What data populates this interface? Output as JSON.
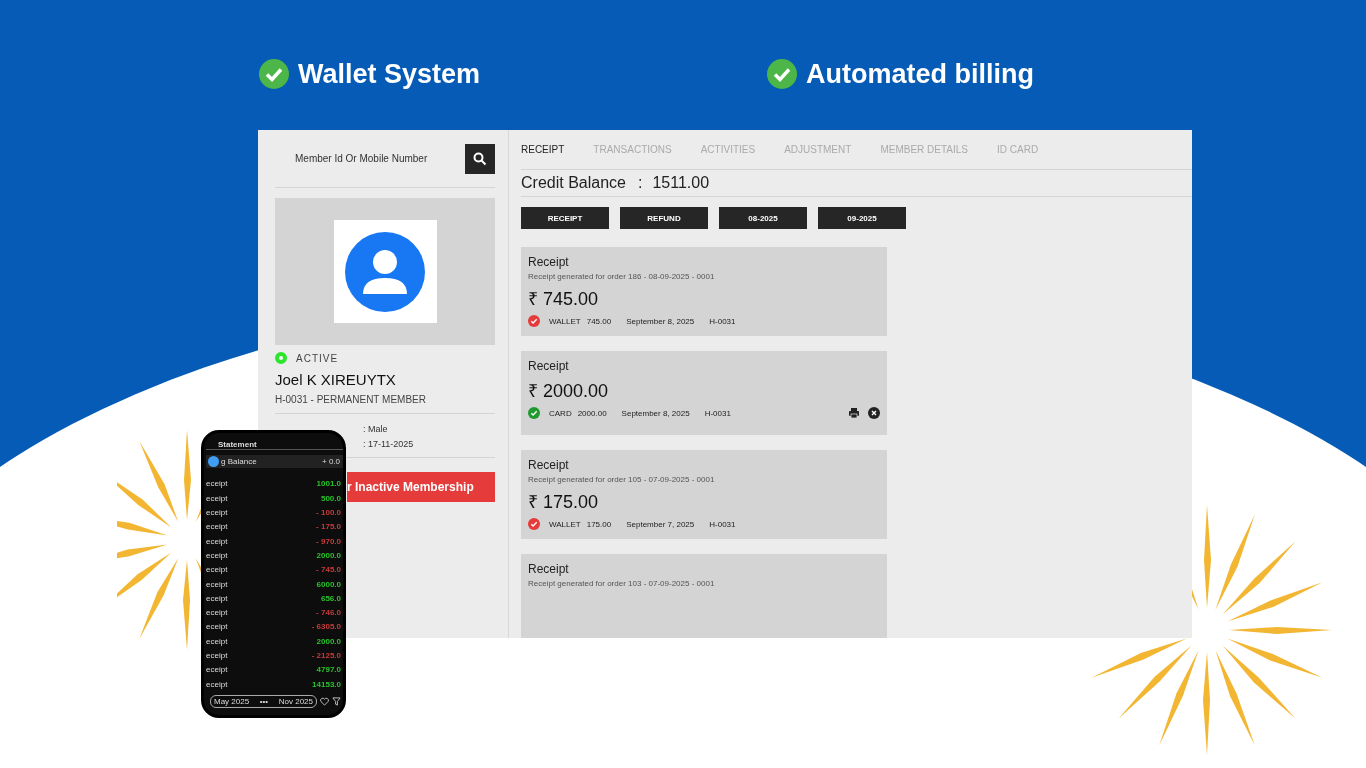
{
  "headlines": [
    {
      "label": "Wallet System"
    },
    {
      "label": "Automated billing"
    }
  ],
  "search": {
    "placeholder": "Member Id Or Mobile Number"
  },
  "member": {
    "status": "ACTIVE",
    "active": true,
    "name": "Joel K XIREUYTX",
    "id_line": "H-0031 - PERMANENT MEMBER",
    "details": [
      ": Male",
      ": 17-11-2025"
    ],
    "action": "r Inactive Membership"
  },
  "tabs": [
    {
      "label": "RECEIPT",
      "selected": true
    },
    {
      "label": "TRANSACTIONS",
      "selected": false
    },
    {
      "label": "ACTIVITIES",
      "selected": false
    },
    {
      "label": "ADJUSTMENT",
      "selected": false
    },
    {
      "label": "MEMBER DETAILS",
      "selected": false
    },
    {
      "label": "ID CARD",
      "selected": false
    }
  ],
  "credit_balance": {
    "label": "Credit Balance",
    "separator": ":",
    "value": "1511.00"
  },
  "buttons": [
    "RECEIPT",
    "REFUND",
    "08-2025",
    "09-2025"
  ],
  "receipts": [
    {
      "title": "Receipt",
      "note": "Receipt generated for order 186 - 08-09-2025 - 0001",
      "amount": "₹ 745.00",
      "color": "#e53b3b",
      "method": "WALLET",
      "paid": "745.00",
      "date": "September 8, 2025",
      "member": "H-0031",
      "actions": false
    },
    {
      "title": "Receipt",
      "amount": "₹ 2000.00",
      "color": "#1f9a2e",
      "method": "CARD",
      "paid": "2000.00",
      "date": "September 8, 2025",
      "member": "H-0031",
      "actions": true
    },
    {
      "title": "Receipt",
      "note": "Receipt generated for order 105 - 07-09-2025 - 0001",
      "amount": "₹ 175.00",
      "color": "#e53b3b",
      "method": "WALLET",
      "paid": "175.00",
      "date": "September 7, 2025",
      "member": "H-0031",
      "actions": false
    },
    {
      "title": "Receipt",
      "note": "Receipt generated for order 103 - 07-09-2025 - 0001",
      "actions": false
    }
  ],
  "phone": {
    "title": "Statement",
    "opening_label": "g Balance",
    "opening_value": "+ 0.0",
    "rows": [
      {
        "label": "eceipt",
        "amount": "1001.0",
        "kind": "credit"
      },
      {
        "label": "eceipt",
        "amount": "500.0",
        "kind": "credit"
      },
      {
        "label": "eceipt",
        "amount": "- 100.0",
        "kind": "debit"
      },
      {
        "label": "eceipt",
        "amount": "- 175.0",
        "kind": "debit"
      },
      {
        "label": "eceipt",
        "amount": "- 970.0",
        "kind": "debit"
      },
      {
        "label": "eceipt",
        "amount": "2000.0",
        "kind": "credit"
      },
      {
        "label": "eceipt",
        "amount": "- 745.0",
        "kind": "debit"
      },
      {
        "label": "eceipt",
        "amount": "6000.0",
        "kind": "credit"
      },
      {
        "label": "eceipt",
        "amount": "656.0",
        "kind": "credit"
      },
      {
        "label": "eceipt",
        "amount": "- 746.0",
        "kind": "debit"
      },
      {
        "label": "eceipt",
        "amount": "- 6305.0",
        "kind": "debit"
      },
      {
        "label": "eceipt",
        "amount": "2000.0",
        "kind": "credit"
      },
      {
        "label": "eceipt",
        "amount": "- 2125.0",
        "kind": "debit"
      },
      {
        "label": "eceipt",
        "amount": "4797.0",
        "kind": "credit"
      },
      {
        "label": "eceipt",
        "amount": "14153.0",
        "kind": "credit"
      }
    ],
    "range_from": "May 2025",
    "range_sep": "•••",
    "range_to": "Nov 2025"
  }
}
